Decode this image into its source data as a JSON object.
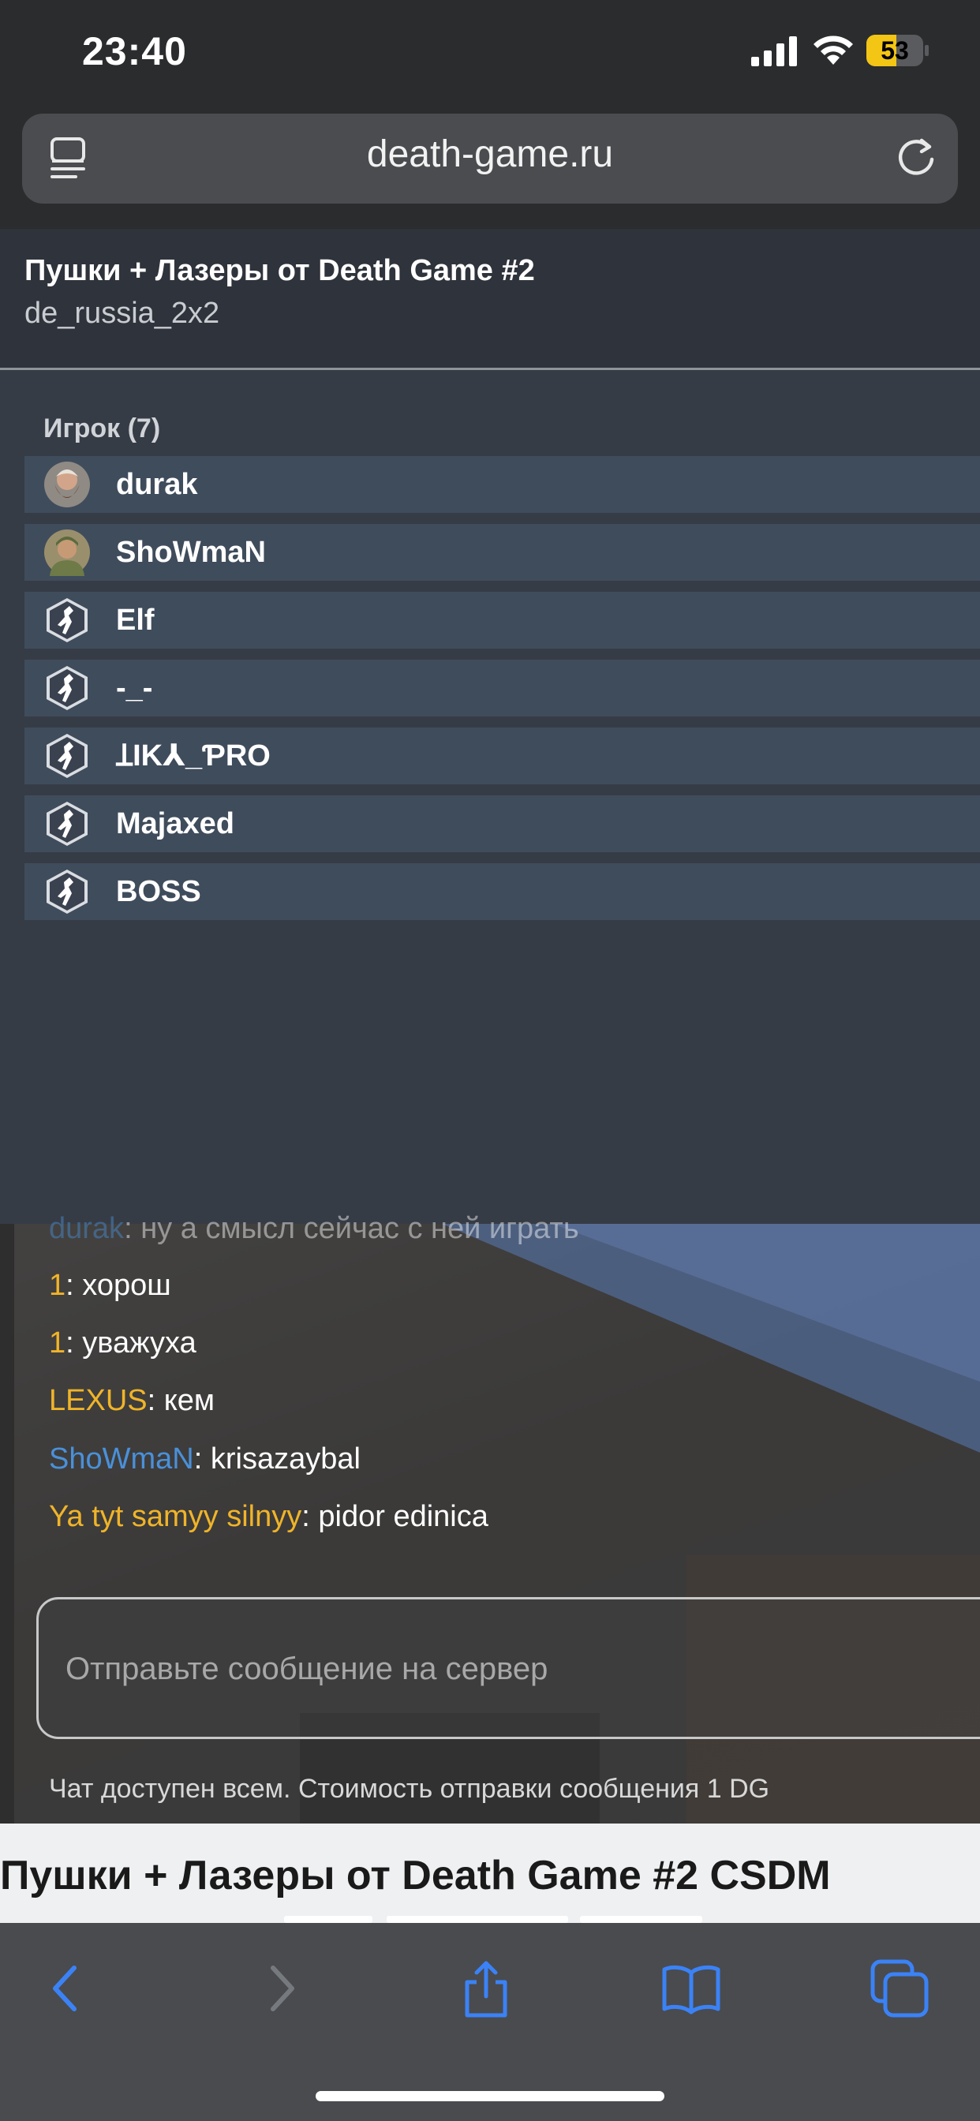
{
  "status_bar": {
    "time": "23:40",
    "battery_percent": "53",
    "battery_level": 0.53,
    "icons": [
      "cellular-signal-icon",
      "wifi-icon",
      "battery-icon"
    ]
  },
  "browser": {
    "url": "death-game.ru",
    "icons": [
      "reader-mode-icon",
      "reload-icon"
    ]
  },
  "server": {
    "title": "Пушки + Лазеры от Death Game #2",
    "map": "de_russia_2x2"
  },
  "players": {
    "heading": "Игрок (7)",
    "list": [
      {
        "name": "durak",
        "avatar": "bearded-avatar"
      },
      {
        "name": "ShoWmaN",
        "avatar": "soldier-avatar"
      },
      {
        "name": "Elf",
        "avatar": "cs-logo-avatar"
      },
      {
        "name": "-_-",
        "avatar": "cs-logo-avatar"
      },
      {
        "name": "ꞱIK⅄_ƤRO",
        "avatar": "cs-logo-avatar"
      },
      {
        "name": "Majaxed",
        "avatar": "cs-logo-avatar"
      },
      {
        "name": "BOSS",
        "avatar": "cs-logo-avatar"
      }
    ]
  },
  "chat": {
    "messages": [
      {
        "nick": "durak",
        "text": "ну а смысл сейчас с ней играть",
        "nick_color": "#4a90d9"
      },
      {
        "nick": "1",
        "text": "хорош",
        "nick_color": "#f0b429"
      },
      {
        "nick": "1",
        "text": "уважуха",
        "nick_color": "#f0b429"
      },
      {
        "nick": "LEXUS",
        "text": "кем",
        "nick_color": "#f0b429"
      },
      {
        "nick": "ShoWmaN",
        "text": "krisazaybal",
        "nick_color": "#4a90d9"
      },
      {
        "nick": "Ya tyt samyy silnyy",
        "text": "pidor edinica",
        "nick_color": "#f0b429"
      }
    ],
    "separator": ":",
    "input_placeholder": "Отправьте сообщение на сервер",
    "note": "Чат доступен всем. Стоимость отправки сообщения 1 DG"
  },
  "page": {
    "title": "Пушки + Лазеры от Death Game #2 CSDM"
  },
  "toolbar": {
    "icons": [
      "back-icon",
      "forward-icon",
      "share-icon",
      "bookmarks-icon",
      "tabs-icon"
    ],
    "accent": "#3b82f6"
  }
}
